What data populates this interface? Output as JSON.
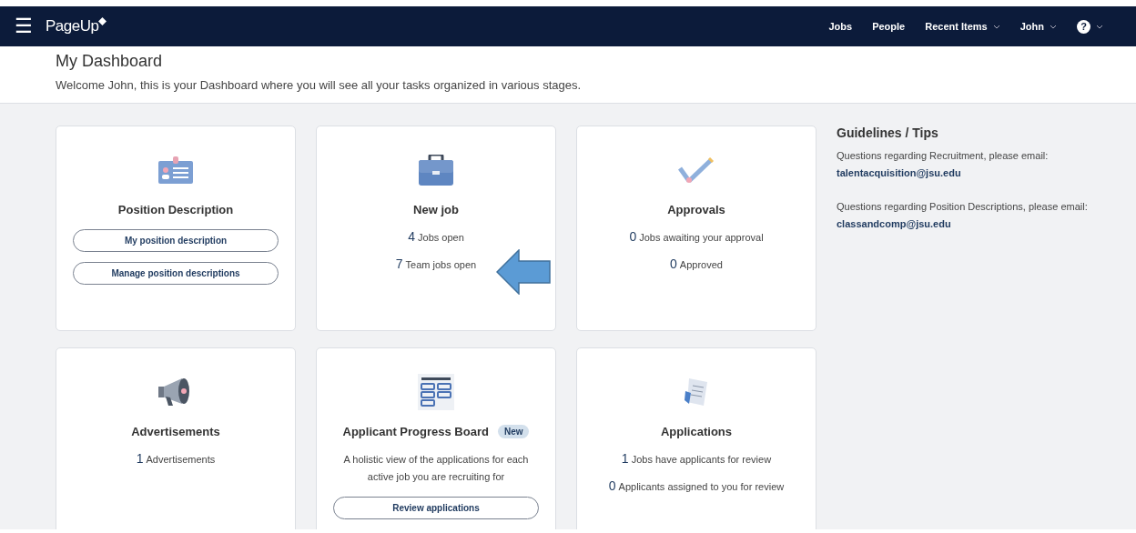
{
  "nav": {
    "menu_icon": "☰",
    "logo": "PageUp",
    "links": [
      {
        "label": "Jobs",
        "dropdown": false
      },
      {
        "label": "People",
        "dropdown": false
      },
      {
        "label": "Recent Items",
        "dropdown": true
      },
      {
        "label": "John",
        "dropdown": true
      },
      {
        "label": "?",
        "dropdown": true
      }
    ]
  },
  "header": {
    "title": "My Dashboard",
    "subtitle": "Welcome John, this is your Dashboard where you will see all your tasks organized in various stages."
  },
  "cards": [
    {
      "kind": "buttons",
      "title": "Position Description",
      "buttons": [
        "My position description",
        "Manage position descriptions"
      ]
    },
    {
      "kind": "stats",
      "title": "New job",
      "stats": [
        {
          "count": "4",
          "label": "Jobs open"
        },
        {
          "count": "7",
          "label": "Team jobs open"
        }
      ]
    },
    {
      "kind": "stats",
      "title": "Approvals",
      "stats": [
        {
          "count": "0",
          "label": "Jobs awaiting your approval"
        },
        {
          "count": "0",
          "label": "Approved"
        }
      ]
    },
    {
      "kind": "stats",
      "title": "Advertisements",
      "stats": [
        {
          "count": "1",
          "label": "Advertisements"
        }
      ]
    },
    {
      "kind": "description",
      "title": "Applicant Progress Board",
      "badge": "New",
      "description": "A holistic view of the applications for each active job you are recruiting for",
      "buttons": [
        "Review applications"
      ]
    },
    {
      "kind": "stats",
      "title": "Applications",
      "stats": [
        {
          "count": "1",
          "label": "Jobs have applicants for review"
        },
        {
          "count": "0",
          "label": "Applicants assigned to you for review"
        }
      ]
    }
  ],
  "guidelines": {
    "title": "Guidelines / Tips",
    "tips": [
      {
        "text": "Questions regarding Recruitment, please email:",
        "email": "talentacquisition@jsu.edu"
      },
      {
        "text": "Questions regarding Position Descriptions, please email:",
        "email": "classandcomp@jsu.edu"
      }
    ]
  }
}
